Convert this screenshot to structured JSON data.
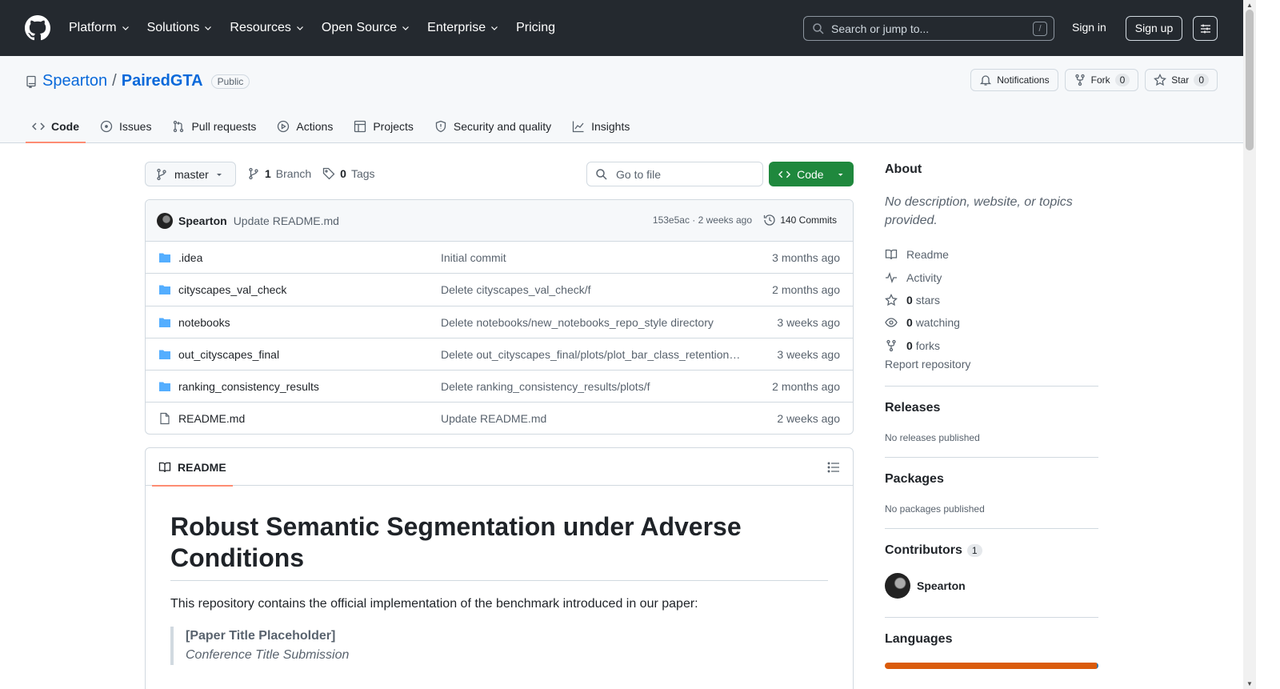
{
  "nav": {
    "items": [
      "Platform",
      "Solutions",
      "Resources",
      "Open Source",
      "Enterprise",
      "Pricing"
    ],
    "search_placeholder": "Search or jump to...",
    "search_key": "/",
    "sign_in": "Sign in",
    "sign_up": "Sign up"
  },
  "repo": {
    "owner": "Spearton",
    "separator": "/",
    "name": "PairedGTA",
    "visibility": "Public",
    "notifications_label": "Notifications",
    "fork_label": "Fork",
    "fork_count": "0",
    "star_label": "Star",
    "star_count": "0"
  },
  "tabs": [
    "Code",
    "Issues",
    "Pull requests",
    "Actions",
    "Projects",
    "Security and quality",
    "Insights"
  ],
  "branch": {
    "name": "master",
    "branch_count": "1",
    "branch_label": "Branch",
    "tag_count": "0",
    "tag_label": "Tags",
    "goto_placeholder": "Go to file",
    "code_label": "Code"
  },
  "latest_commit": {
    "author": "Spearton",
    "message": "Update README.md",
    "meta": "153e5ac · 2 weeks ago",
    "commits": "140 Commits"
  },
  "files": [
    {
      "type": "folder",
      "name": ".idea",
      "commit": "Initial commit",
      "time": "3 months ago"
    },
    {
      "type": "folder",
      "name": "cityscapes_val_check",
      "commit": "Delete cityscapes_val_check/f",
      "time": "2 months ago"
    },
    {
      "type": "folder",
      "name": "notebooks",
      "commit": "Delete notebooks/new_notebooks_repo_style directory",
      "time": "3 weeks ago"
    },
    {
      "type": "folder",
      "name": "out_cityscapes_final",
      "commit": "Delete out_cityscapes_final/plots/plot_bar_class_retention_all_images.png",
      "time": "3 weeks ago"
    },
    {
      "type": "folder",
      "name": "ranking_consistency_results",
      "commit": "Delete ranking_consistency_results/plots/f",
      "time": "2 months ago"
    },
    {
      "type": "file",
      "name": "README.md",
      "commit": "Update README.md",
      "time": "2 weeks ago"
    }
  ],
  "readme": {
    "tab_label": "README",
    "title": "Robust Semantic Segmentation under Adverse Conditions",
    "intro": "This repository contains the official implementation of the benchmark introduced in our paper:",
    "quote_title": "[Paper Title Placeholder]",
    "quote_subtitle": "Conference Title Submission"
  },
  "sidebar": {
    "about_heading": "About",
    "about_desc": "No description, website, or topics provided.",
    "readme": "Readme",
    "activity": "Activity",
    "stars_count": "0",
    "stars_label": "stars",
    "watching_count": "0",
    "watching_label": "watching",
    "forks_count": "0",
    "forks_label": "forks",
    "report": "Report repository",
    "releases_heading": "Releases",
    "releases_text": "No releases published",
    "packages_heading": "Packages",
    "packages_text": "No packages published",
    "contributors_heading": "Contributors",
    "contributors_count": "1",
    "contributor_name": "Spearton",
    "languages_heading": "Languages",
    "language_colors": [
      "#DA5B0B",
      "#3572A5"
    ]
  }
}
